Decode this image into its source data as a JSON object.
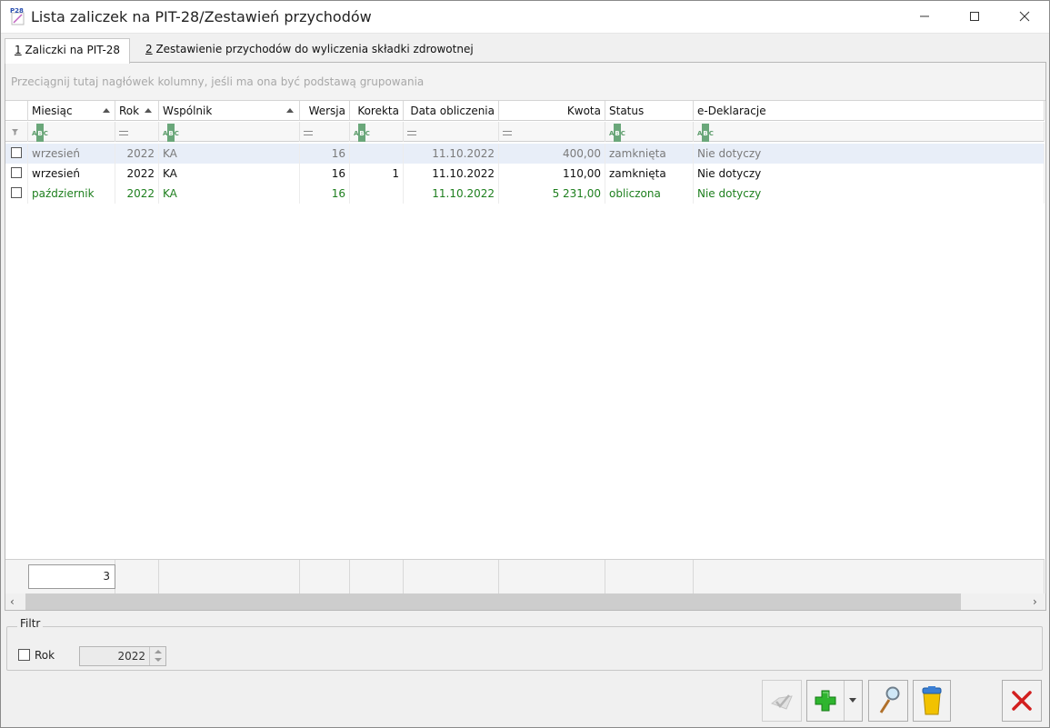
{
  "window": {
    "title": "Lista zaliczek na PIT-28/Zestawień przychodów",
    "icon_text": "P28"
  },
  "tabs": [
    {
      "key": "1",
      "label": " Zaliczki na PIT-28"
    },
    {
      "key": "2",
      "label": " Zestawienie przychodów do wyliczenia składki zdrowotnej"
    }
  ],
  "grid": {
    "group_hint": "Przeciągnij tutaj nagłówek kolumny, jeśli ma ona być podstawą grupowania",
    "columns": [
      "Miesiąc",
      "Rok",
      "Wspólnik",
      "Wersja",
      "Korekta",
      "Data obliczenia",
      "Kwota",
      "Status",
      "e-Deklaracje"
    ],
    "rows": [
      {
        "miesiac": "wrzesień",
        "rok": "2022",
        "wspolnik": "KA",
        "wersja": "16",
        "korekta": "",
        "data": "11.10.2022",
        "kwota": "400,00",
        "status": "zamknięta",
        "edekl": "Nie dotyczy"
      },
      {
        "miesiac": "wrzesień",
        "rok": "2022",
        "wspolnik": "KA",
        "wersja": "16",
        "korekta": "1",
        "data": "11.10.2022",
        "kwota": "110,00",
        "status": "zamknięta",
        "edekl": "Nie dotyczy"
      },
      {
        "miesiac": "październik",
        "rok": "2022",
        "wspolnik": "KA",
        "wersja": "16",
        "korekta": "",
        "data": "11.10.2022",
        "kwota": "5 231,00",
        "status": "obliczona",
        "edekl": "Nie dotyczy"
      }
    ],
    "row_count": "3"
  },
  "filter": {
    "legend": "Filtr",
    "rok_label": "Rok",
    "rok_value": "2022"
  },
  "colors": {
    "closed_text": "#7a7a7a",
    "calculated_text": "#1e7f1e",
    "selected_row": "#e8eef8"
  }
}
